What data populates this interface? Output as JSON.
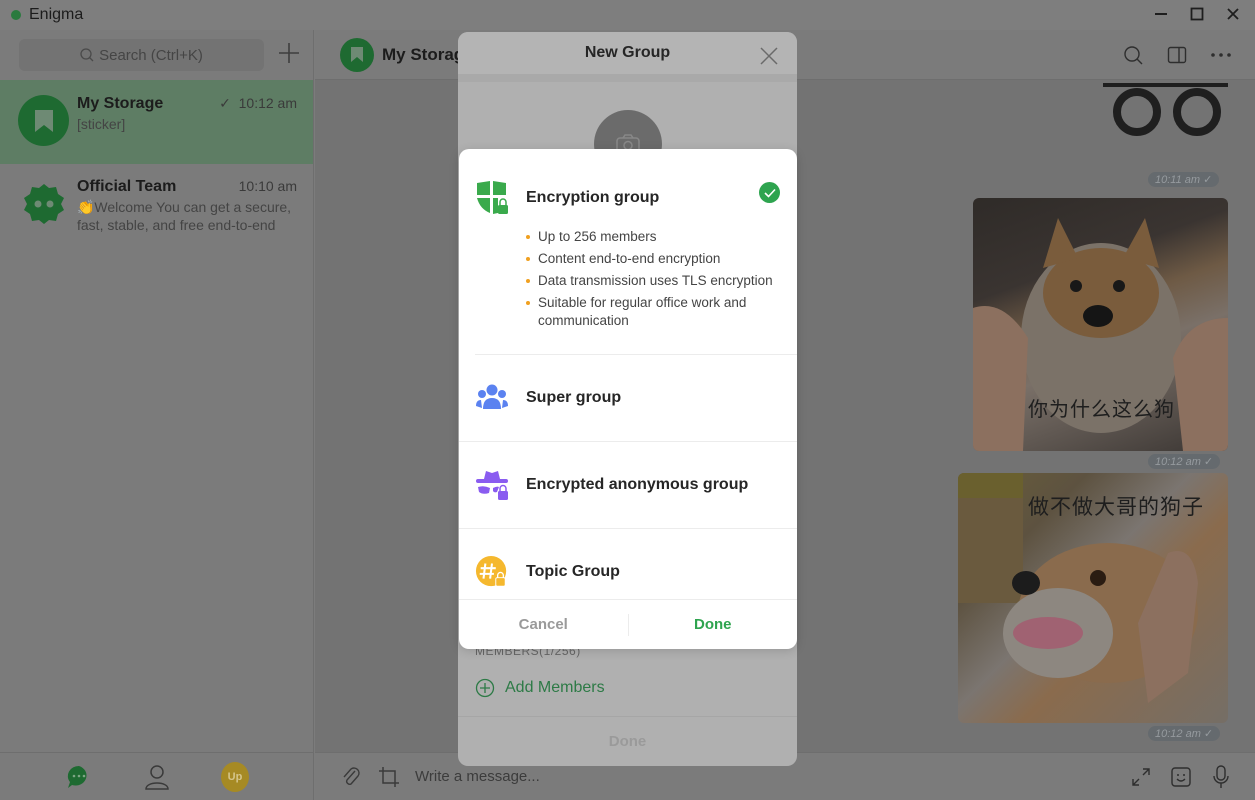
{
  "window": {
    "title": "Enigma",
    "controls": [
      "minimize",
      "maximize",
      "close"
    ]
  },
  "sidebar": {
    "search_placeholder": "Search (Ctrl+K)",
    "chats": [
      {
        "name": "My Storage",
        "preview": "[sticker]",
        "time": "10:12 am",
        "read_check": "✓",
        "active": true
      },
      {
        "name": "Official Team",
        "preview": "👏Welcome You can get a secure, fast, stable, and free end-to-end",
        "time": "10:10 am",
        "active": false
      }
    ],
    "bottom_nav": {
      "chats_icon": "chat-bubble-icon",
      "contacts_icon": "person-icon",
      "profile_avatar_text": "Up"
    }
  },
  "conversation": {
    "title": "My Storage",
    "messages": [
      {
        "type": "sticker",
        "time": "10:11 am ✓"
      },
      {
        "type": "image",
        "caption": "你为什么这么狗",
        "time": "10:12 am ✓"
      },
      {
        "type": "image",
        "caption": "做不做大哥的狗子",
        "time": "10:12 am ✓"
      }
    ],
    "input_placeholder": "Write a message..."
  },
  "new_group_dialog": {
    "title": "New Group",
    "members_label": "MEMBERS(1/256)",
    "add_members_label": "Add Members",
    "done_label": "Done"
  },
  "group_type_popup": {
    "options": [
      {
        "label": "Encryption group",
        "icon": "shield-lock-icon",
        "color": "#3aaa4c",
        "selected": true,
        "features": [
          "Up to 256 members",
          "Content end-to-end encryption",
          "Data transmission uses TLS encryption",
          "Suitable for regular office work and communication"
        ]
      },
      {
        "label": "Super group",
        "icon": "people-group-icon",
        "color": "#5b82f0",
        "selected": false
      },
      {
        "label": "Encrypted anonymous group",
        "icon": "anonymous-lock-icon",
        "color": "#8a5cf0",
        "selected": false
      },
      {
        "label": "Topic Group",
        "icon": "hashtag-lock-icon",
        "color": "#f5b82e",
        "selected": false
      }
    ],
    "cancel_label": "Cancel",
    "done_label": "Done",
    "accent_color": "#2ea44f"
  }
}
